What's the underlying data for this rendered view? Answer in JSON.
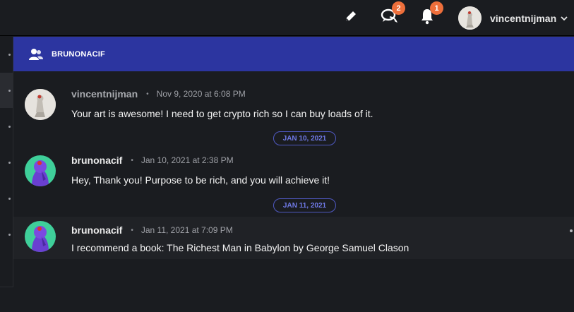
{
  "topbar": {
    "icons": [
      "pencil-icon",
      "chat-icon",
      "bell-icon"
    ],
    "chat_badge": "2",
    "notification_badge": "1",
    "username": "vincentnijman"
  },
  "header": {
    "title": "BRUNONACIF",
    "icon": "user-group-icon"
  },
  "messages": [
    {
      "author": "vincentnijman",
      "time": "Nov 9, 2020 at 6:08 PM",
      "text": "Your art is awesome! I need to get crypto rich so I can buy loads of it."
    },
    {
      "author": "brunonacif",
      "time": "Jan 10, 2021 at 2:38 PM",
      "text": "Hey, Thank you! Purpose to be rich, and you will achieve it!"
    },
    {
      "author": "brunonacif",
      "time": "Jan 11, 2021 at 7:09 PM",
      "text": "I recommend a book: The Richest Man in Babylon by George Samuel Clason"
    }
  ],
  "date_dividers": [
    "JAN 10, 2021",
    "JAN 11, 2021"
  ],
  "colors": {
    "background": "#1a1c20",
    "header": "#2c35a0",
    "badge": "#ee6f3b",
    "divider_border": "#4f59c2",
    "divider_text": "#6f79e6"
  }
}
